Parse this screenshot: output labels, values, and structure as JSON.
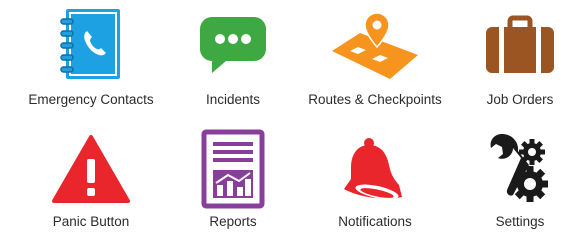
{
  "tiles": [
    {
      "label": "Emergency Contacts",
      "icon": "phone-book-icon",
      "color": "#1da1e2"
    },
    {
      "label": "Incidents",
      "icon": "chat-bubble-icon",
      "color": "#3ea843"
    },
    {
      "label": "Routes & Checkpoints",
      "icon": "route-pin-icon",
      "color": "#f7941d"
    },
    {
      "label": "Job Orders",
      "icon": "briefcase-icon",
      "color": "#9b5523"
    },
    {
      "label": "Panic Button",
      "icon": "warning-icon",
      "color": "#e8262b"
    },
    {
      "label": "Reports",
      "icon": "report-chart-icon",
      "color": "#8a3e9b"
    },
    {
      "label": "Notifications",
      "icon": "bell-icon",
      "color": "#e8262b"
    },
    {
      "label": "Settings",
      "icon": "gear-wrench-icon",
      "color": "#222222"
    }
  ]
}
